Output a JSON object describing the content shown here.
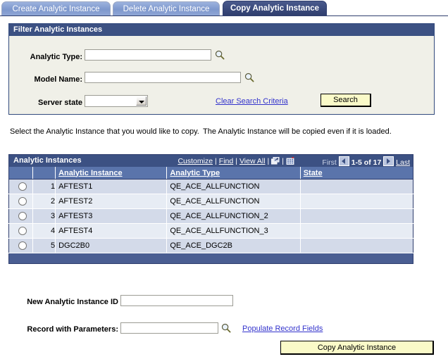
{
  "tabs": [
    {
      "label": "Create Analytic Instance",
      "active": false
    },
    {
      "label": "Delete Analytic Instance",
      "active": false
    },
    {
      "label": "Copy Analytic Instance",
      "active": true
    }
  ],
  "filter": {
    "header": "Filter Analytic Instances",
    "analytic_type": {
      "label": "Analytic Type:",
      "value": "",
      "placeholder": "",
      "lookup_icon": "magnifier-icon"
    },
    "model_name": {
      "label": "Model Name:",
      "value": "",
      "placeholder": "",
      "lookup_icon": "magnifier-icon"
    },
    "server_state": {
      "label": "Server state",
      "value": "",
      "options": [
        ""
      ]
    },
    "clear_link": "Clear Search Criteria",
    "search_button": "Search"
  },
  "instructions": {
    "left": "Select the Analytic Instance that you would like to copy.",
    "right": "The Analytic Instance will be copied even if it is loaded."
  },
  "grid": {
    "title": "Analytic Instances",
    "tools": {
      "customize": "Customize",
      "find": "Find",
      "view_all": "View All",
      "separator": "|",
      "expand_icon": "expand-window-icon",
      "download_icon": "download-grid-icon"
    },
    "nav": {
      "first": "First",
      "prev_icon": "previous-page-arrow-icon",
      "range": "1-5 of 17",
      "next_icon": "next-page-arrow-icon",
      "last": "Last"
    },
    "columns": [
      "",
      "",
      "Analytic Instance",
      "Analytic Type",
      "State"
    ],
    "rows": [
      {
        "num": "1",
        "instance": "AFTEST1",
        "type": "QE_ACE_ALLFUNCTION",
        "state": "",
        "selected": false
      },
      {
        "num": "2",
        "instance": "AFTEST2",
        "type": "QE_ACE_ALLFUNCTION",
        "state": "",
        "selected": false
      },
      {
        "num": "3",
        "instance": "AFTEST3",
        "type": "QE_ACE_ALLFUNCTION_2",
        "state": "",
        "selected": false
      },
      {
        "num": "4",
        "instance": "AFTEST4",
        "type": "QE_ACE_ALLFUNCTION_3",
        "state": "",
        "selected": false
      },
      {
        "num": "5",
        "instance": "DGC2B0",
        "type": "QE_ACE_DGC2B",
        "state": "",
        "selected": false
      }
    ]
  },
  "bottom": {
    "new_instance_id": {
      "label": "New Analytic Instance ID",
      "value": "",
      "placeholder": ""
    },
    "record_params": {
      "label": "Record with Parameters:",
      "value": "",
      "placeholder": "",
      "lookup_icon": "magnifier-icon"
    },
    "populate_link": "Populate Record Fields",
    "copy_button": "Copy Analytic Instance"
  },
  "colors": {
    "header_navy": "#3c5183",
    "grid_header_blue": "#5a74ab",
    "tab_inactive": "#8fa7d6",
    "tab_active": "#3a4a7c",
    "row_odd": "#d3dae9",
    "row_even": "#e7ecf4",
    "button_yellow": "#fafac8",
    "link_blue": "#3333cc",
    "panel_bg": "#f0f0e8"
  }
}
